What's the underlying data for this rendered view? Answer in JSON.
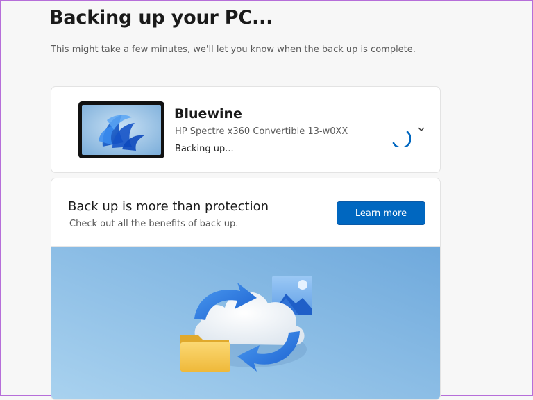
{
  "page": {
    "title": "Backing up your PC...",
    "subtitle": "This might take a few minutes, we'll let you know when the back up is complete."
  },
  "device": {
    "name": "Bluewine",
    "model": "HP Spectre x360 Convertible 13-w0XX",
    "status": "Backing up...",
    "thumbnail_icon": "windows-bloom-wallpaper-icon",
    "progress_icon": "spinner-icon",
    "expand_icon": "chevron-down-icon"
  },
  "promo": {
    "title": "Back up is more than protection",
    "subtitle": "Check out all the benefits of back up.",
    "button_label": "Learn more",
    "illustration_icons": [
      "cloud-sync-icon",
      "folder-icon",
      "photo-icon"
    ]
  },
  "colors": {
    "accent": "#0067c0",
    "background": "#f7f7f7",
    "card": "#ffffff",
    "illustration_sky": "#8fc1e6"
  }
}
